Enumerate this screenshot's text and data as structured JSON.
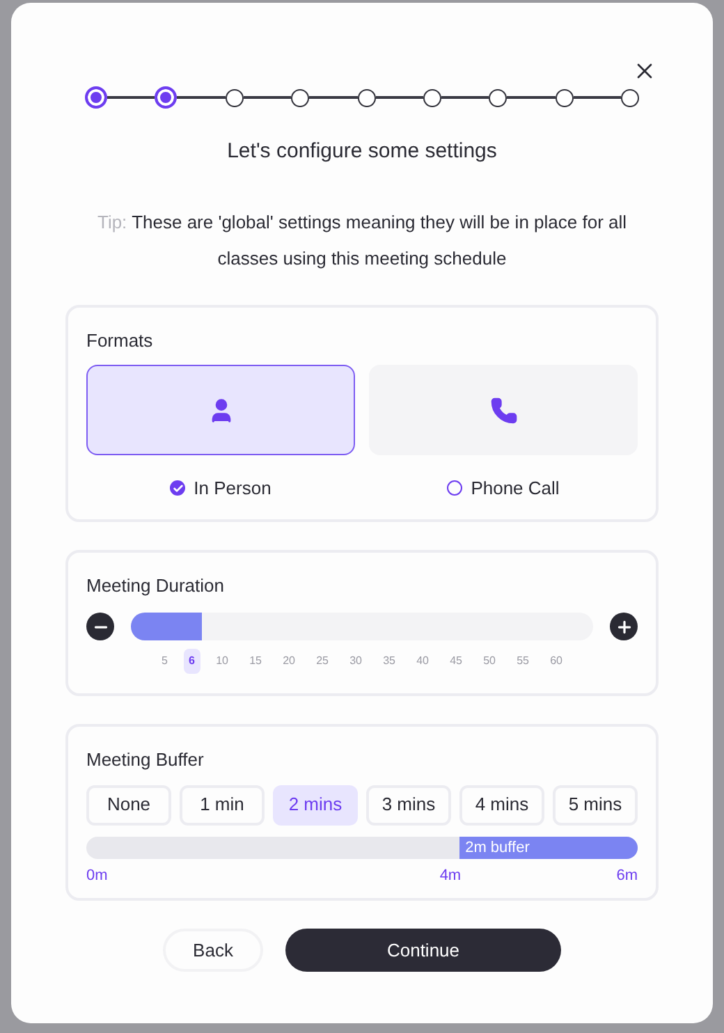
{
  "stepper": {
    "steps": [
      {
        "done": true
      },
      {
        "done": true
      },
      {
        "done": false
      },
      {
        "done": false
      },
      {
        "done": false
      },
      {
        "done": false
      },
      {
        "done": false
      },
      {
        "done": false
      },
      {
        "done": false
      }
    ]
  },
  "heading": "Let's configure some settings",
  "tip": {
    "label": "Tip:",
    "text": "These are 'global' settings meaning they will be in place for all classes using this meeting schedule"
  },
  "formats": {
    "title": "Formats",
    "options": [
      {
        "kind": "person",
        "label": "In Person",
        "selected": true
      },
      {
        "kind": "phone",
        "label": "Phone Call",
        "selected": false
      }
    ]
  },
  "duration": {
    "title": "Meeting Duration",
    "level": 0.155,
    "ticks": [
      {
        "label": "5",
        "selected": false
      },
      {
        "label": "6",
        "selected": true
      },
      {
        "label": "10",
        "selected": false
      },
      {
        "label": "15",
        "selected": false
      },
      {
        "label": "20",
        "selected": false
      },
      {
        "label": "25",
        "selected": false
      },
      {
        "label": "30",
        "selected": false
      },
      {
        "label": "35",
        "selected": false
      },
      {
        "label": "40",
        "selected": false
      },
      {
        "label": "45",
        "selected": false
      },
      {
        "label": "50",
        "selected": false
      },
      {
        "label": "55",
        "selected": false
      },
      {
        "label": "60",
        "selected": false
      }
    ]
  },
  "buffer": {
    "title": "Meeting Buffer",
    "options": [
      {
        "label": "None",
        "selected": false
      },
      {
        "label": "1 min",
        "selected": false
      },
      {
        "label": "2 mins",
        "selected": true
      },
      {
        "label": "3 mins",
        "selected": false
      },
      {
        "label": "4 mins",
        "selected": false
      },
      {
        "label": "5 mins",
        "selected": false
      }
    ],
    "bar": {
      "label": "2m buffer",
      "level": 0.323
    },
    "scale": [
      "0m",
      "4m",
      "6m"
    ]
  },
  "buttons": {
    "back": "Back",
    "continue": "Continue"
  }
}
